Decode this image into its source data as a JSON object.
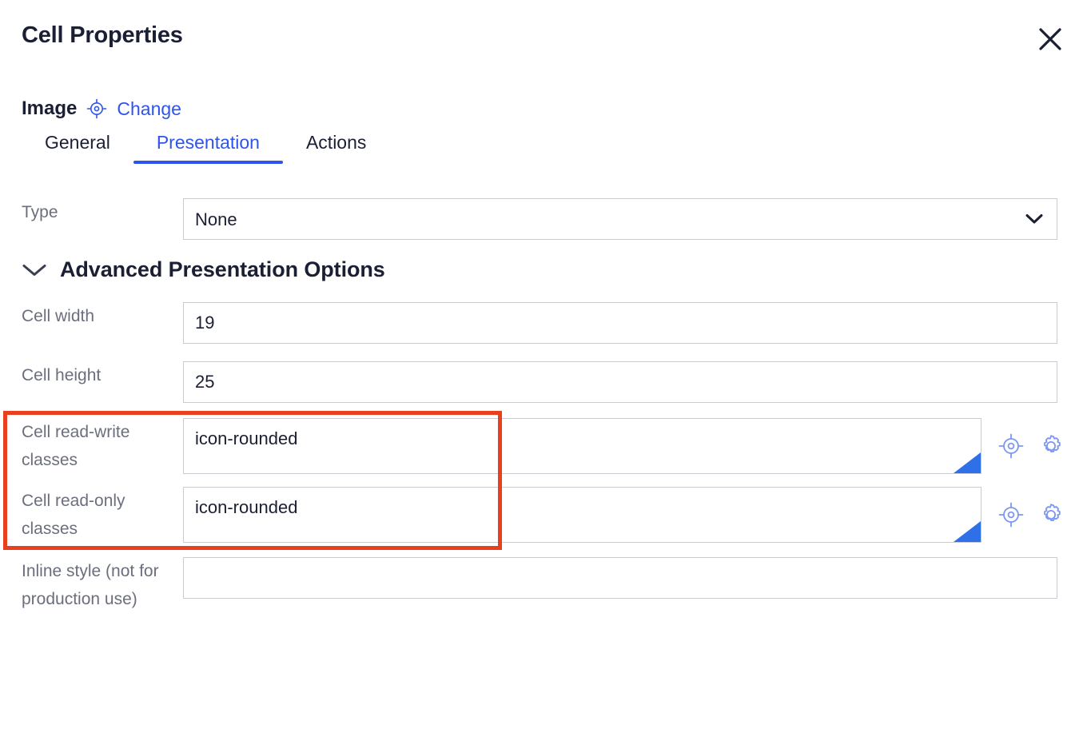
{
  "dialog": {
    "title": "Cell Properties",
    "close_icon": "close-icon"
  },
  "object": {
    "label": "Image",
    "target_icon": "target-crosshair-icon",
    "change_link": "Change"
  },
  "tabs": [
    {
      "label": "General",
      "active": false
    },
    {
      "label": "Presentation",
      "active": true
    },
    {
      "label": "Actions",
      "active": false
    }
  ],
  "fields": {
    "type": {
      "label": "Type",
      "value": "None",
      "chevron_icon": "chevron-down-icon"
    },
    "cell_width": {
      "label": "Cell width",
      "value": "19",
      "placeholder": ""
    },
    "cell_height": {
      "label": "Cell height",
      "value": "25",
      "placeholder": ""
    },
    "cell_read_write_classes": {
      "label": "Cell read-write classes",
      "value": "icon-rounded",
      "placeholder": "",
      "target_icon": "target-crosshair-icon",
      "gear_icon": "gear-icon",
      "resize_handle_icon": "resize-handle-icon"
    },
    "cell_read_only_classes": {
      "label": "Cell read-only classes",
      "value": "icon-rounded",
      "placeholder": "",
      "target_icon": "target-crosshair-icon",
      "gear_icon": "gear-icon",
      "resize_handle_icon": "resize-handle-icon"
    },
    "inline_style": {
      "label": "Inline style (not for production use)",
      "value": "",
      "placeholder": ""
    }
  },
  "section": {
    "title": "Advanced Presentation Options",
    "chevron_icon": "chevron-down-icon",
    "expanded": true
  },
  "colors": {
    "accent": "#2f54eb",
    "text": "#1b1f33",
    "muted": "#6b6f7d",
    "border": "#c9cbd0",
    "highlight": "#e8401f",
    "background": "#ffffff"
  }
}
